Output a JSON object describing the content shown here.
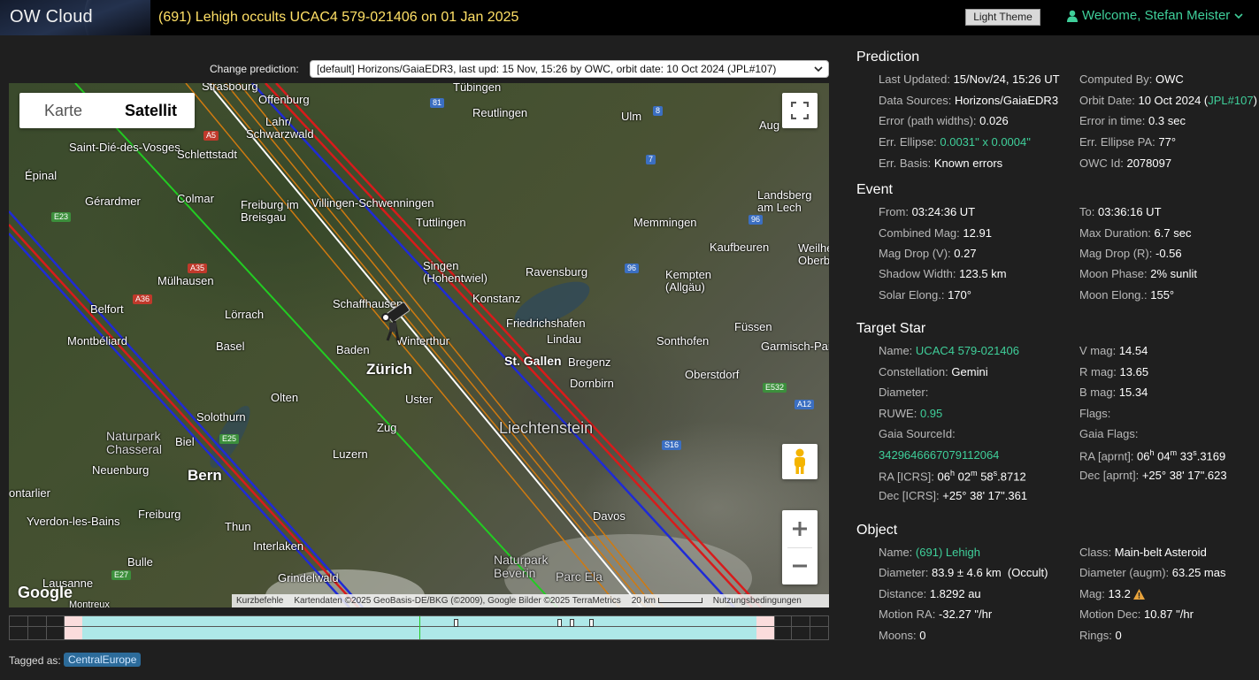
{
  "header": {
    "logo": "OW Cloud",
    "event_title": "(691) Lehigh occults UCAC4 579-021406 on 01 Jan 2025",
    "theme_button": "Light Theme",
    "welcome": "Welcome, Stefan Meister"
  },
  "chooser": {
    "label": "Change prediction:",
    "selected": "[default] Horizons/GaiaEDR3, last upd: 15 Nov, 15:26 by OWC, orbit date: 10 Oct 2024 (JPL#107)"
  },
  "map": {
    "tabs": [
      "Karte",
      "Satellit"
    ],
    "active_tab": "Satellit",
    "cities": {
      "strasbourg": "Strasbourg",
      "tubingen": "Tübingen",
      "offenburg": "Offenburg",
      "reutlingen": "Reutlingen",
      "ulm": "Ulm",
      "augsburg": "Aug",
      "lahr": "Lahr/",
      "schwarzwald": "Schwarzwald",
      "saint_die": "Saint-Dié-des-Vosges",
      "schlettstadt": "Schlettstadt",
      "epinal": "Épinal",
      "gerardmer": "Gérardmer",
      "colmar": "Colmar",
      "freiburg_breisgau": "Freiburg im\nBreisgau",
      "villingen": "Villingen-Schwenningen",
      "tuttlingen": "Tuttlingen",
      "memmingen": "Memmingen",
      "landsberg": "Landsberg\nam Lech",
      "kaufbeuren": "Kaufbeuren",
      "weilheim": "Weilhe\nOberb",
      "mulhausen": "Mülhausen",
      "singen": "Singen\n(Hohentwiel)",
      "ravensburg": "Ravensburg",
      "kempten": "Kempten\n(Allgäu)",
      "belfort": "Belfort",
      "lorrach": "Lörrach",
      "schaffhausen": "Schaffhausen",
      "konstanz": "Konstanz",
      "friedrichshafen": "Friedrichshafen",
      "lindau": "Lindau",
      "fussen": "Füssen",
      "montbeliard": "Montbéliard",
      "basel": "Basel",
      "baden": "Baden",
      "winterthur": "Winterthur",
      "sontofen": "Sonthofen",
      "garmisch": "Garmisch-Par",
      "zurich": "Zürich",
      "stgallen": "St. Gallen",
      "bregenz": "Bregenz",
      "dornbirn": "Dornbirn",
      "oberstdorf": "Oberstdorf",
      "olten": "Olten",
      "uster": "Uster",
      "solothurn": "Solothurn",
      "liechtenstein": "Liechtenstein",
      "naturpark": "Naturpark\nChasseral",
      "biel": "Biel",
      "zug": "Zug",
      "luzern": "Luzern",
      "neuenburg": "Neuenburg",
      "bern": "Bern",
      "ontarlier": "ontarlier",
      "yverdon": "Yverdon-les-Bains",
      "freiburg": "Freiburg",
      "thun": "Thun",
      "interlaken": "Interlaken",
      "davos": "Davos",
      "bulle": "Bulle",
      "grindelwald": "Grindelwald",
      "naturpark_beverin": "Naturpark\nBeverin",
      "parc_ela": "Parc Ela",
      "lausanne": "Lausanne",
      "montreux": "Montreux"
    },
    "roads": {
      "a5": "A5",
      "r81": "81",
      "r8": "8",
      "r7": "7",
      "e23": "E23",
      "r96a": "96",
      "r96b": "96",
      "a35": "A35",
      "a36": "A36",
      "e532": "E532",
      "a12": "A12",
      "s16": "S16",
      "e25": "E25",
      "e27": "E27"
    },
    "google": "Google",
    "attribution": {
      "shortcuts": "Kurzbefehle",
      "data": "Kartendaten ©2025 GeoBasis-DE/BKG (©2009), Google Bilder ©2025 TerraMetrics",
      "scale": "20 km",
      "terms": "Nutzungsbedingungen"
    },
    "colors": {
      "center": "#ffffff",
      "limits": "#1f2bd6",
      "uncertainty": "#d81b1b",
      "sigma": "#d07a10",
      "observer": "#22cc22"
    }
  },
  "tagged": {
    "label": "Tagged as:",
    "tag": "CentralEurope"
  },
  "prediction": {
    "title": "Prediction",
    "last_updated_label": "Last Updated:",
    "last_updated": "15/Nov/24, 15:26 UT",
    "computed_by_label": "Computed By:",
    "computed_by": "OWC",
    "sources_label": "Data Sources:",
    "sources": "Horizons/GaiaEDR3",
    "orbit_label": "Orbit Date:",
    "orbit_date": "10 Oct 2024 (",
    "orbit_link": "JPL#107",
    "orbit_close": ")",
    "err_paths_label": "Error (path widths):",
    "err_paths": "0.026",
    "err_time_label": "Error in time:",
    "err_time": "0.3 sec",
    "ellipse_label": "Err. Ellipse:",
    "ellipse": "0.0031\" x 0.0004\"",
    "ellipse_pa_label": "Err. Ellipse PA:",
    "ellipse_pa": "77°",
    "basis_label": "Err. Basis:",
    "basis": "Known errors",
    "owc_id_label": "OWC Id:",
    "owc_id": "2078097"
  },
  "event": {
    "title": "Event",
    "from_label": "From:",
    "from": "03:24:36 UT",
    "to_label": "To:",
    "to": "03:36:16 UT",
    "combined_label": "Combined Mag:",
    "combined": "12.91",
    "max_dur_label": "Max Duration:",
    "max_dur": "6.7 sec",
    "drop_v_label": "Mag Drop (V):",
    "drop_v": "0.27",
    "drop_r_label": "Mag Drop (R):",
    "drop_r": "-0.56",
    "shadow_label": "Shadow Width:",
    "shadow": "123.5 km",
    "moon_phase_label": "Moon Phase:",
    "moon_phase": "2% sunlit",
    "solar_label": "Solar Elong.:",
    "solar": "170°",
    "moon_elong_label": "Moon Elong.:",
    "moon_elong": "155°"
  },
  "target": {
    "title": "Target Star",
    "name_label": "Name:",
    "name": "UCAC4 579-021406",
    "vmag_label": "V mag:",
    "vmag": "14.54",
    "const_label": "Constellation:",
    "const": "Gemini",
    "rmag_label": "R mag:",
    "rmag": "13.65",
    "diam_label": "Diameter:",
    "bmag_label": "B mag:",
    "bmag": "15.34",
    "ruwe_label": "RUWE:",
    "ruwe": "0.95",
    "flags_label": "Flags:",
    "gaia_id_label": "Gaia SourceId:",
    "gaia_flags_label": "Gaia Flags:",
    "gaia_id": "3429646667079112064",
    "ra_aprnt_label": "RA [aprnt]:",
    "ra_aprnt_h": "06",
    "ra_aprnt_m": "04",
    "ra_aprnt_s": "33",
    "ra_aprnt_frac": ".3169",
    "ra_icrs_label": "RA [ICRS]:",
    "ra_icrs_h": "06",
    "ra_icrs_m": "02",
    "ra_icrs_s": "58",
    "ra_icrs_frac": ".8712",
    "dec_aprnt_label": "Dec [aprnt]:",
    "dec_aprnt": "+25° 38' 17\".623",
    "dec_icrs_label": "Dec [ICRS]:",
    "dec_icrs": "+25° 38' 17\".361"
  },
  "object": {
    "title": "Object",
    "name_label": "Name:",
    "name": "(691) Lehigh",
    "class_label": "Class:",
    "class": "Main-belt Asteroid",
    "diam_label": "Diameter:",
    "diam": "83.9 ± 4.6 km",
    "diam_src": "(Occult)",
    "diam_augm_label": "Diameter (augm):",
    "diam_augm": "63.25 mas",
    "dist_label": "Distance:",
    "dist": "1.8292 au",
    "mag_label": "Mag:",
    "mag": "13.2",
    "mra_label": "Motion RA:",
    "mra": "-32.27 \"/hr",
    "mdec_label": "Motion Dec:",
    "mdec": "10.87 \"/hr",
    "moons_label": "Moons:",
    "moons": "0",
    "rings_label": "Rings:",
    "rings": "0"
  }
}
